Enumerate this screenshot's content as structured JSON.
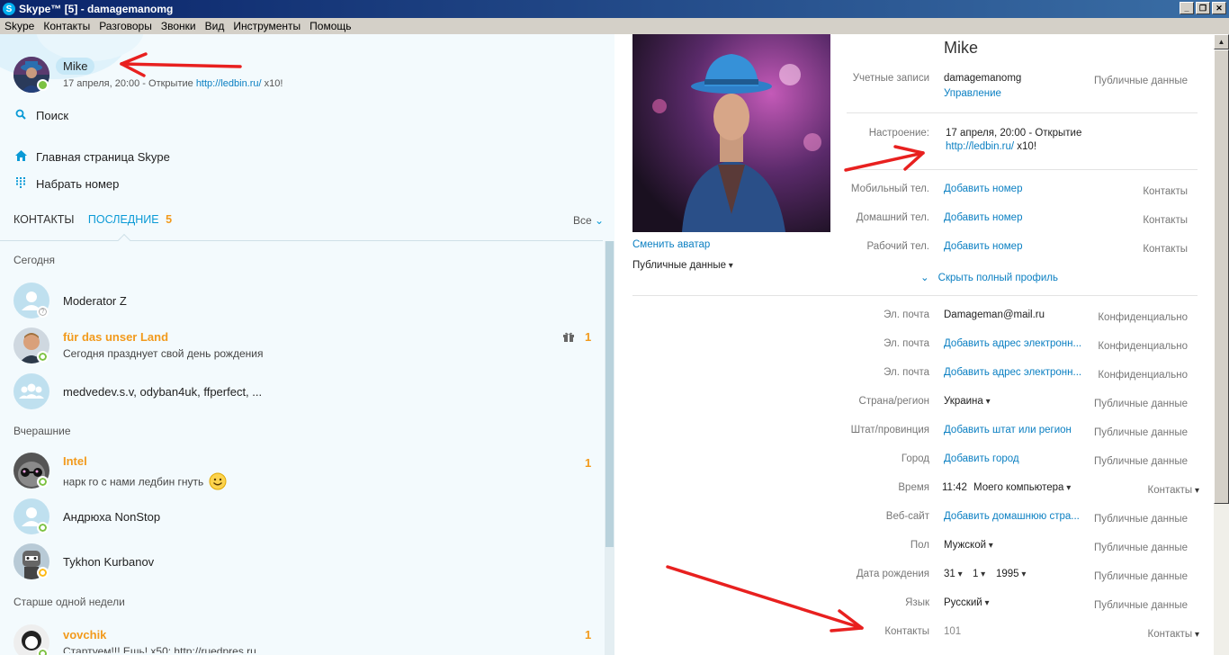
{
  "window": {
    "title": "Skype™ [5] - damagemanomg",
    "app_glyph": "S",
    "minimize": "_",
    "restore": "❐",
    "close": "✕"
  },
  "menu": [
    "Skype",
    "Контакты",
    "Разговоры",
    "Звонки",
    "Вид",
    "Инструменты",
    "Помощь"
  ],
  "me": {
    "name": "Mike",
    "mood_prefix": "17 апреля, 20:00 - Открытие ",
    "mood_link": "http://ledbin.ru/",
    "mood_suffix": " x10!"
  },
  "nav": {
    "search": "Поиск",
    "home": "Главная страница Skype",
    "dial": "Набрать номер"
  },
  "tabs": {
    "contacts": "КОНТАКТЫ",
    "recent": "ПОСЛЕДНИЕ",
    "recent_count": "5",
    "filter": "Все"
  },
  "sections": {
    "today": "Сегодня",
    "yesterday": "Вчерашние",
    "older": "Старше одной недели"
  },
  "contacts": [
    {
      "name": "Moderator Z",
      "sub": "",
      "badge": ""
    },
    {
      "name": "für das unser Land",
      "sub": "Сегодня празднует свой день рождения",
      "badge": "1"
    },
    {
      "name": "medvedev.s.v, odyban4uk, ffperfect, ...",
      "sub": "",
      "badge": ""
    },
    {
      "name": "Intel",
      "sub": "нарк го с нами ледбин гнуть",
      "badge": "1"
    },
    {
      "name": "Андрюха NonStop",
      "sub": "",
      "badge": ""
    },
    {
      "name": "Tykhon Kurbanov",
      "sub": "",
      "badge": ""
    },
    {
      "name": "vovchik",
      "sub": "Стартуем!!! Ешь! х50: http://ruedpres.ru",
      "badge": "1"
    }
  ],
  "profile": {
    "name": "Mike",
    "change_avatar": "Сменить аватар",
    "visibility": "Публичные данные",
    "accounts_label": "Учетные записи",
    "accounts_value": "damagemanomg",
    "manage": "Управление",
    "accounts_priv": "Публичные данные",
    "mood_label": "Настроение:",
    "mood_line1": "17 апреля, 20:00 - Открытие",
    "mood_link": "http://ledbin.ru/",
    "mood_suffix": " x10!",
    "phones": [
      {
        "label": "Мобильный тел.",
        "value": "Добавить номер",
        "priv": "Контакты"
      },
      {
        "label": "Домашний тел.",
        "value": "Добавить номер",
        "priv": "Контакты"
      },
      {
        "label": "Рабочий тел.",
        "value": "Добавить номер",
        "priv": "Контакты"
      }
    ],
    "hide_full": "Скрыть полный профиль",
    "fields": [
      {
        "label": "Эл. почта",
        "value": "Damageman@mail.ru",
        "priv": "Конфиденциально"
      },
      {
        "label": "Эл. почта",
        "value": "Добавить адрес электронн...",
        "priv": "Конфиденциально"
      },
      {
        "label": "Эл. почта",
        "value": "Добавить адрес электронн...",
        "priv": "Конфиденциально"
      },
      {
        "label": "Страна/регион",
        "value": "Украина",
        "priv": "Публичные данные"
      },
      {
        "label": "Штат/провинция",
        "value": "Добавить штат или регион",
        "priv": "Публичные данные"
      },
      {
        "label": "Город",
        "value": "Добавить город",
        "priv": "Публичные данные"
      },
      {
        "label": "Время",
        "value": "11:42",
        "value2": "Моего компьютера",
        "priv": "Контакты"
      },
      {
        "label": "Веб-сайт",
        "value": "Добавить домашнюю стра...",
        "priv": "Публичные данные"
      },
      {
        "label": "Пол",
        "value": "Мужской",
        "priv": "Публичные данные"
      },
      {
        "label": "Дата рождения",
        "day": "31",
        "month": "1",
        "year": "1995",
        "priv": "Публичные данные"
      },
      {
        "label": "Язык",
        "value": "Русский",
        "priv": "Публичные данные"
      },
      {
        "label": "Контакты",
        "value": "101",
        "priv": "Контакты"
      }
    ]
  },
  "colors": {
    "accent": "#0a9ad6",
    "unread": "#f29a1c",
    "online": "#7cc242",
    "away": "#fdb913",
    "annotation": "#e8201f"
  }
}
